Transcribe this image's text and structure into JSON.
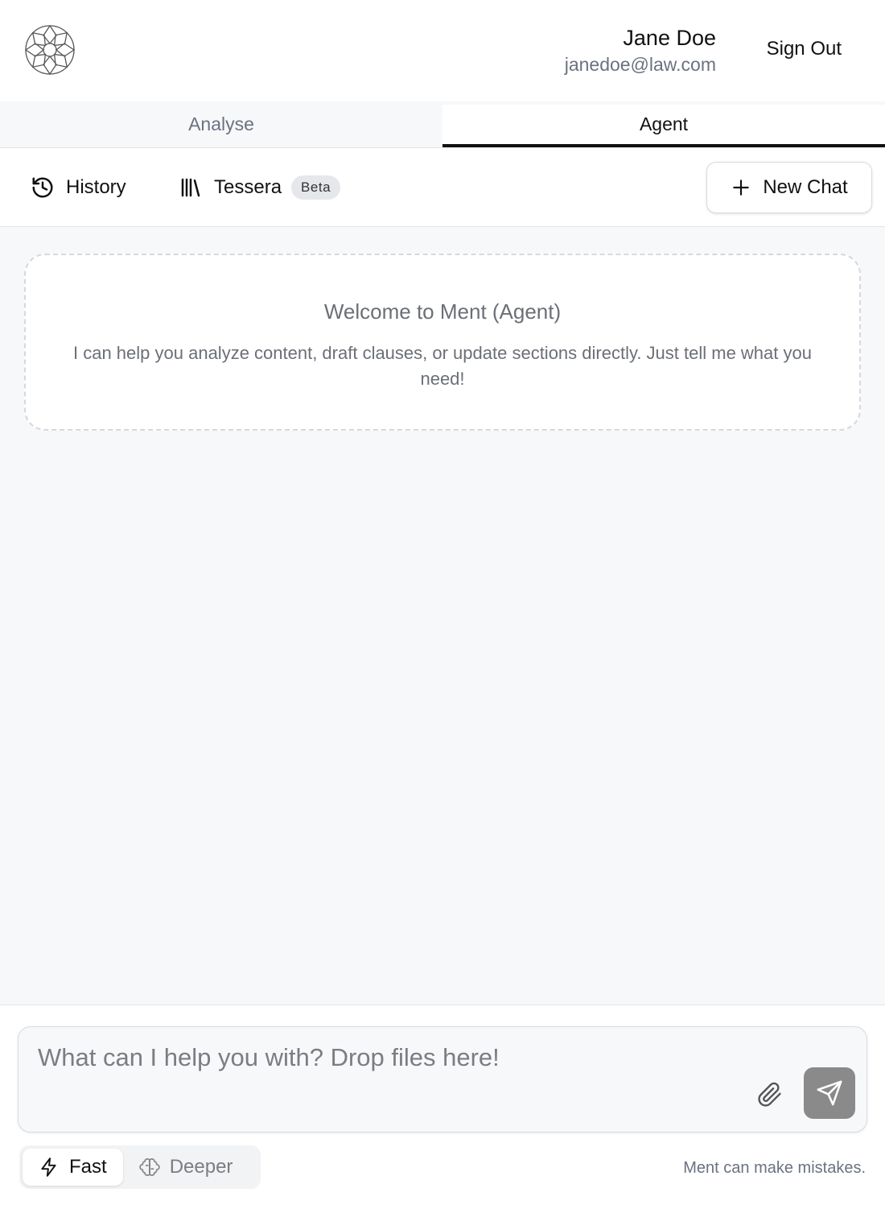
{
  "user": {
    "name": "Jane Doe",
    "email": "janedoe@law.com",
    "sign_out_label": "Sign Out"
  },
  "tabs": [
    {
      "label": "Analyse",
      "active": false
    },
    {
      "label": "Agent",
      "active": true
    }
  ],
  "toolbar": {
    "history_label": "History",
    "tessera_label": "Tessera",
    "beta_badge": "Beta",
    "new_chat_label": "New Chat"
  },
  "welcome": {
    "title": "Welcome to Ment (Agent)",
    "text": "I can help you analyze content, draft clauses, or update sections directly. Just tell me what you need!"
  },
  "composer": {
    "placeholder": "What can I help you with? Drop files here!",
    "value": ""
  },
  "modes": [
    {
      "label": "Fast",
      "icon": "lightning-icon",
      "active": true
    },
    {
      "label": "Deeper",
      "icon": "brain-icon",
      "active": false
    }
  ],
  "disclaimer": "Ment can make mistakes.",
  "colors": {
    "accent": "#111111",
    "send_button": "#8a8a8a",
    "main_bg": "#f7f8fa"
  }
}
